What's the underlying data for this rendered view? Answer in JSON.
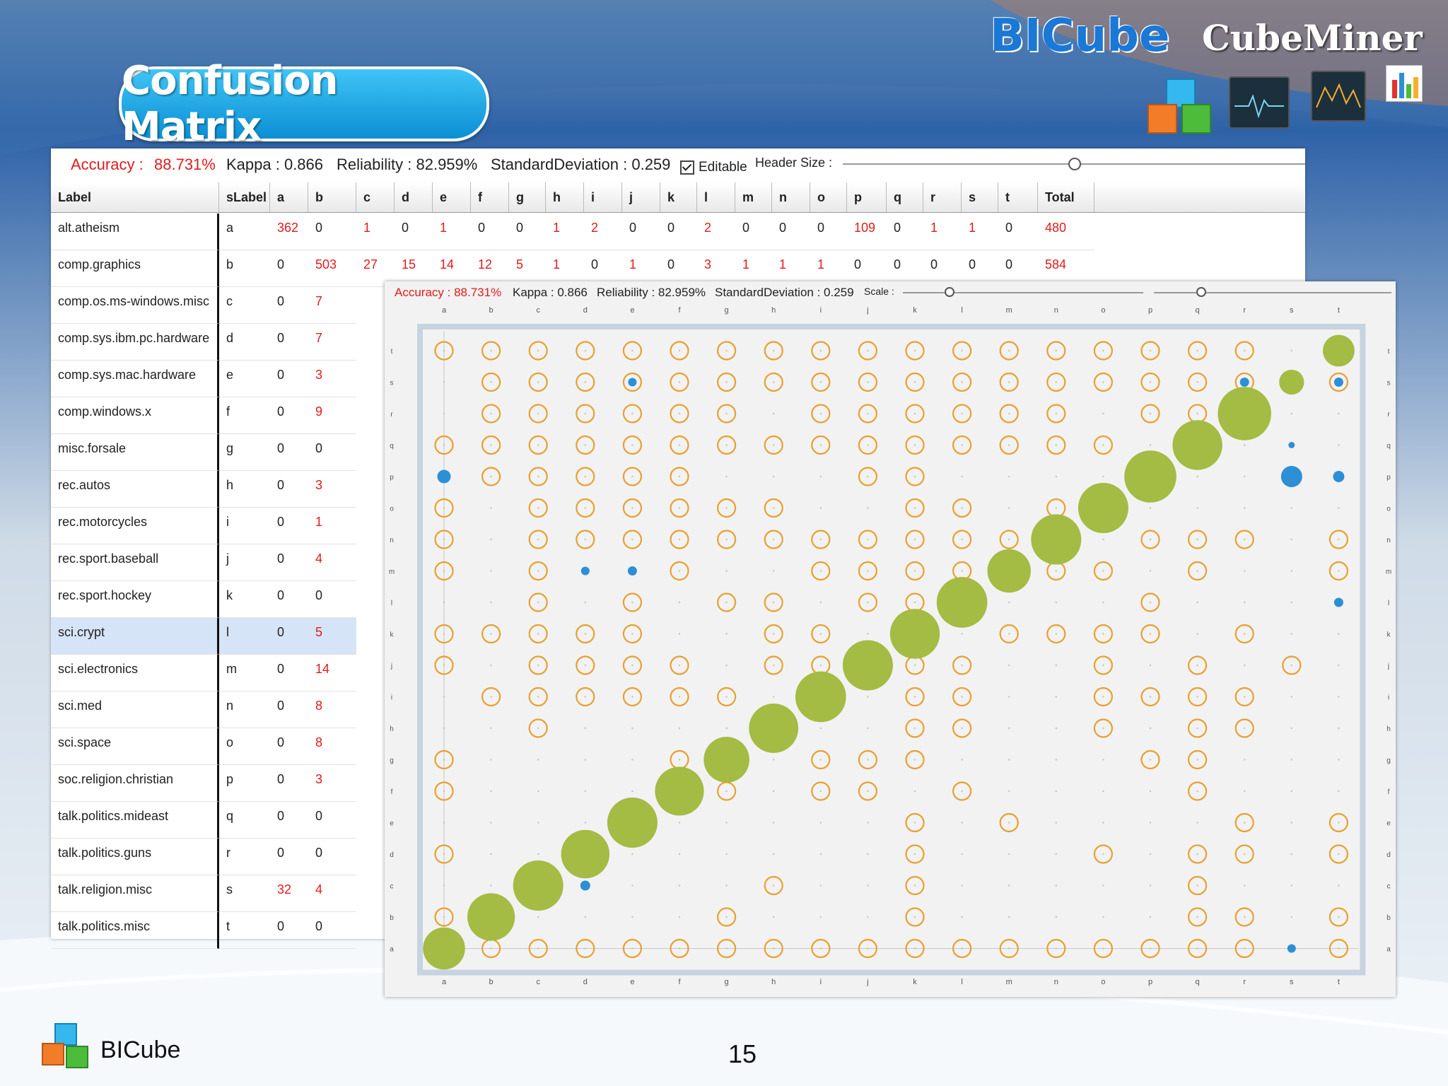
{
  "header": {
    "title": "Confusion Matrix",
    "brand": "BICube",
    "product": "CubeMiner"
  },
  "stats": {
    "accuracy_label": "Accuracy :",
    "accuracy_value": "88.731%",
    "kappa": "Kappa : 0.866",
    "reliability": "Reliability : 82.959%",
    "std": "StandardDeviation : 0.259",
    "editable": "Editable",
    "header_size": "Header Size :",
    "header_size_level": 0.5
  },
  "table": {
    "columns": [
      "Label",
      "sLabel",
      "a",
      "b",
      "c",
      "d",
      "e",
      "f",
      "g",
      "h",
      "i",
      "j",
      "k",
      "l",
      "m",
      "n",
      "o",
      "p",
      "q",
      "r",
      "s",
      "t",
      "Total"
    ],
    "rows": [
      {
        "label": "alt.atheism",
        "slabel": "a",
        "a": "362",
        "b": "0",
        "rest": [
          "1",
          "0",
          "1",
          "0",
          "0",
          "1",
          "2",
          "0",
          "0",
          "2",
          "0",
          "0",
          "0",
          "109",
          "0",
          "1",
          "1",
          "0",
          "480"
        ]
      },
      {
        "label": "comp.graphics",
        "slabel": "b",
        "a": "0",
        "b": "503",
        "rest": [
          "27",
          "15",
          "14",
          "12",
          "5",
          "1",
          "0",
          "1",
          "0",
          "3",
          "1",
          "1",
          "1",
          "0",
          "0",
          "0",
          "0",
          "0",
          "584"
        ]
      },
      {
        "label": "comp.os.ms-windows.misc",
        "slabel": "c",
        "a": "0",
        "b": "7"
      },
      {
        "label": "comp.sys.ibm.pc.hardware",
        "slabel": "d",
        "a": "0",
        "b": "7"
      },
      {
        "label": "comp.sys.mac.hardware",
        "slabel": "e",
        "a": "0",
        "b": "3"
      },
      {
        "label": "comp.windows.x",
        "slabel": "f",
        "a": "0",
        "b": "9"
      },
      {
        "label": "misc.forsale",
        "slabel": "g",
        "a": "0",
        "b": "0"
      },
      {
        "label": "rec.autos",
        "slabel": "h",
        "a": "0",
        "b": "3"
      },
      {
        "label": "rec.motorcycles",
        "slabel": "i",
        "a": "0",
        "b": "1"
      },
      {
        "label": "rec.sport.baseball",
        "slabel": "j",
        "a": "0",
        "b": "4"
      },
      {
        "label": "rec.sport.hockey",
        "slabel": "k",
        "a": "0",
        "b": "0"
      },
      {
        "label": "sci.crypt",
        "slabel": "l",
        "a": "0",
        "b": "5"
      },
      {
        "label": "sci.electronics",
        "slabel": "m",
        "a": "0",
        "b": "14"
      },
      {
        "label": "sci.med",
        "slabel": "n",
        "a": "0",
        "b": "8"
      },
      {
        "label": "sci.space",
        "slabel": "o",
        "a": "0",
        "b": "8"
      },
      {
        "label": "soc.religion.christian",
        "slabel": "p",
        "a": "0",
        "b": "3"
      },
      {
        "label": "talk.politics.mideast",
        "slabel": "q",
        "a": "0",
        "b": "0"
      },
      {
        "label": "talk.politics.guns",
        "slabel": "r",
        "a": "0",
        "b": "0"
      },
      {
        "label": "talk.religion.misc",
        "slabel": "s",
        "a": "32",
        "b": "4"
      },
      {
        "label": "talk.politics.misc",
        "slabel": "t",
        "a": "0",
        "b": "0"
      }
    ]
  },
  "overlay": {
    "accuracy": "Accuracy : 88.731%",
    "kappa": "Kappa : 0.866",
    "reliability": "Reliability : 82.959%",
    "std": "StandardDeviation : 0.259",
    "scale": "Scale :"
  },
  "chart_data": {
    "type": "scatter",
    "categories": [
      "a",
      "b",
      "c",
      "d",
      "e",
      "f",
      "g",
      "h",
      "i",
      "j",
      "k",
      "l",
      "m",
      "n",
      "o",
      "p",
      "q",
      "r",
      "s",
      "t"
    ],
    "diagonal_size": [
      0.68,
      0.8,
      0.86,
      0.82,
      0.86,
      0.83,
      0.76,
      0.84,
      0.87,
      0.86,
      0.85,
      0.87,
      0.71,
      0.86,
      0.86,
      0.9,
      0.85,
      0.93,
      0.3,
      0.45
    ],
    "colors": {
      "diagonal": "#a4bb44",
      "error_ring": "#e8a031",
      "small_error": "#2d8fd6"
    },
    "rings": [
      "t:abcdefghijklmnopqr",
      "s:bcdefghijklmnopqrt",
      "r:bcdefgijklmnpq",
      "q:abcdefghijklmno",
      "p:bcdefjk",
      "o:acdefghkln",
      "n:acdefghijklmnpqrt",
      "m:acfijklnoqt",
      "l:ceghjkp",
      "k:abcdehikmnopr",
      "j:acdefhikloqs",
      "i:bcdefgklopqr",
      "h:ckloqr",
      "g:afijkpq",
      "f:agijlq",
      "e:kmrt",
      "d:akoqrt",
      "c:hkq",
      "b:agkqrt",
      "a:bcdefghijklmnopqrt"
    ],
    "blue_dots": [
      [
        "p",
        "a",
        1.3
      ],
      [
        "p",
        "s",
        2.4
      ],
      [
        "p",
        "t",
        1.0
      ],
      [
        "s",
        "r",
        0.7
      ],
      [
        "s",
        "t",
        0.7
      ],
      [
        "s",
        "e",
        0.6
      ],
      [
        "q",
        "s",
        0.3
      ],
      [
        "m",
        "e",
        0.7
      ],
      [
        "m",
        "d",
        0.6
      ],
      [
        "c",
        "d",
        0.8
      ],
      [
        "a",
        "s",
        0.6
      ],
      [
        "l",
        "t",
        0.7
      ]
    ]
  }
}
